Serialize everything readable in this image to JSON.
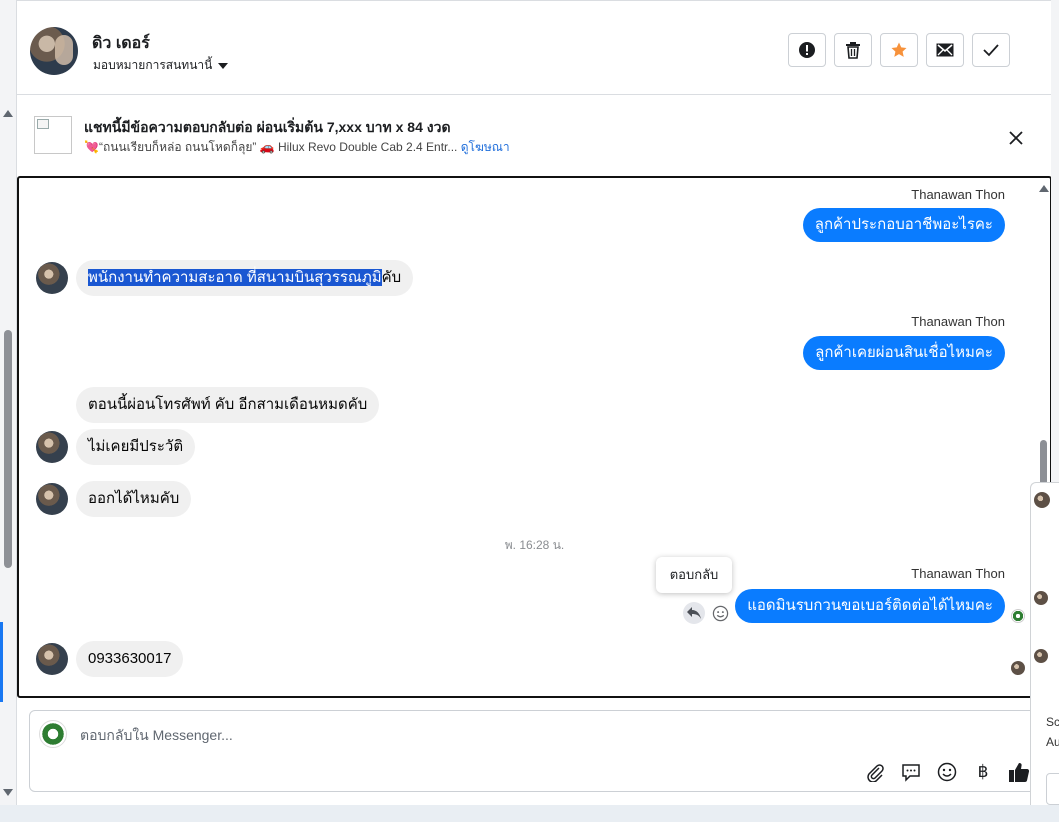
{
  "header": {
    "contact_name": "ดิว เดอร์",
    "assign_label": "มอบหมายการสนทนานี้",
    "actions": [
      {
        "name": "report",
        "icon": "alert-circle-icon"
      },
      {
        "name": "delete",
        "icon": "trash-icon"
      },
      {
        "name": "star",
        "icon": "star-icon",
        "color": "#f7923b"
      },
      {
        "name": "mark-unread",
        "icon": "envelope-icon"
      },
      {
        "name": "done",
        "icon": "check-icon"
      }
    ]
  },
  "ad": {
    "title": "แชทนี้มีข้อความตอบกลับต่อ ผ่อนเริ่มต้น 7,xxx บาท x 84 งวด",
    "subtitle": "💘“ถนนเรียบก็หล่อ ถนนโหดก็ลุย” 🚗 Hilux Revo Double Cab 2.4 Entr...",
    "link": "ดูโฆษณา"
  },
  "messages": {
    "m1_sender": "Thanawan Thon",
    "m1_text": "ลูกค้าประกอบอาชีพอะไรคะ",
    "m2_text_selected": "พนักงานทำความสะอาด ที่สนามบินสุวรรณภูมิ",
    "m2_text_rest": "คับ",
    "m3_sender": "Thanawan Thon",
    "m3_text": "ลูกค้าเคยผ่อนสินเชื่อไหมคะ",
    "m4_text": "ตอนนี้ผ่อนโทรศัพท์ คับ อีกสามเดือนหมดคับ",
    "m5_text": "ไม่เคยมีประวัติ",
    "m6_text": "ออกได้ไหมคับ",
    "timestamp": "พ. 16:28 น.",
    "tooltip": "ตอบกลับ",
    "m7_sender": "Thanawan Thon",
    "m7_text": "แอดมินรบกวนขอเบอร์ติดต่อได้ไหมคะ",
    "m8_text": "0933630017"
  },
  "composer": {
    "placeholder": "ตอบกลับใน Messenger...",
    "currency_symbol": "฿"
  },
  "mini_panel": {
    "line1": "Sc",
    "line2": "Au"
  },
  "colors": {
    "outgoing_bubble": "#0a7cff",
    "incoming_bubble": "#f0f0f0",
    "selection": "#1a57d2",
    "link": "#216fdb"
  }
}
